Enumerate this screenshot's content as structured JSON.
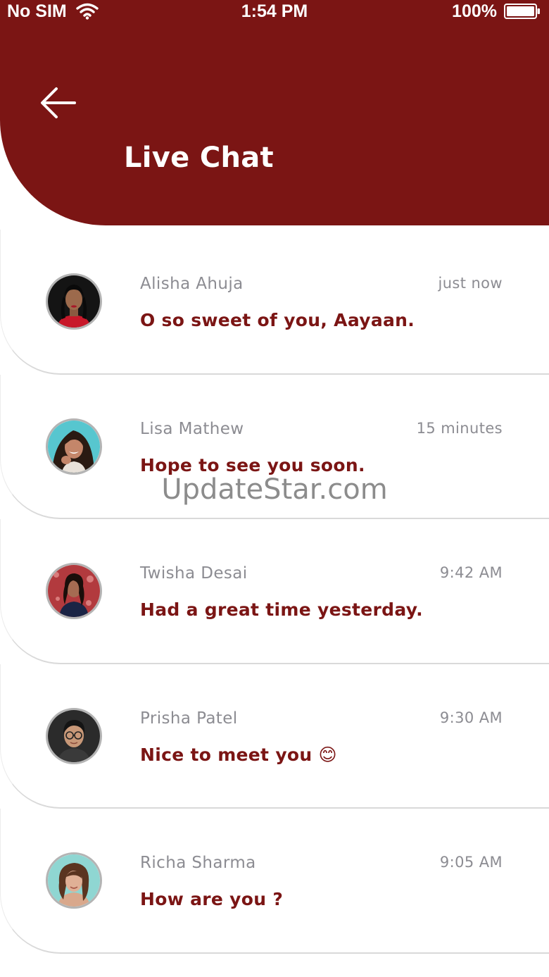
{
  "status_bar": {
    "carrier": "No SIM",
    "time": "1:54 PM",
    "battery": "100%"
  },
  "header": {
    "title": "Live Chat",
    "back_icon": "arrow-left-icon",
    "background_color": "#7b1514"
  },
  "colors": {
    "accent": "#7b1514",
    "name_text": "#8c8c92"
  },
  "chats": [
    {
      "name": "Alisha Ahuja",
      "time": "just now",
      "message": "O so sweet of you, Aayaan."
    },
    {
      "name": "Lisa Mathew",
      "time": "15 minutes",
      "message": "Hope to see you soon."
    },
    {
      "name": "Twisha Desai",
      "time": "9:42 AM",
      "message": "Had a great time yesterday."
    },
    {
      "name": "Prisha Patel",
      "time": "9:30 AM",
      "message": "Nice to meet you 😊"
    },
    {
      "name": "Richa Sharma",
      "time": "9:05 AM",
      "message": "How are you ?"
    }
  ],
  "watermark": "UpdateStar.com"
}
